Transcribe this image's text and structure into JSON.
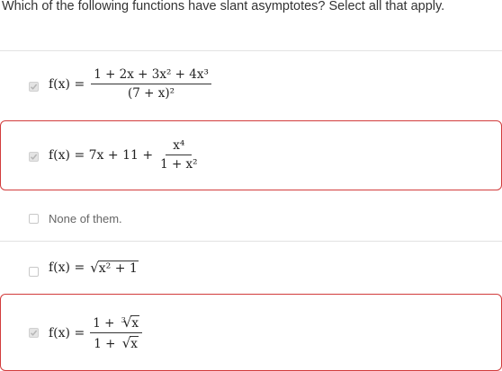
{
  "question": "Which of the following functions have slant asymptotes? Select all that apply.",
  "options": [
    {
      "checked": true,
      "marked": false,
      "lhs": "f(x) =",
      "numerator": "1 + 2x + 3x² + 4x³",
      "denominator": "(7 + x)²"
    },
    {
      "checked": true,
      "marked": true,
      "lhs": "f(x) = 7x + 11 +",
      "numerator": "x⁴",
      "denominator": "1 + x²"
    },
    {
      "checked": false,
      "marked": false,
      "label": "None of them."
    },
    {
      "checked": false,
      "marked": false,
      "lhs": "f(x) =",
      "radicand": "x² + 1"
    },
    {
      "checked": true,
      "marked": true,
      "lhs": "f(x) =",
      "numerator_prefix": "1 +",
      "numerator_radicand": "x",
      "numerator_root_index": "3",
      "denominator_prefix": "1 +",
      "denominator_radicand": "x"
    }
  ],
  "colors": {
    "marked_border": "#d23c3c",
    "divider": "#e2e2e2",
    "checkbox_checked": "#e4e4e4"
  }
}
